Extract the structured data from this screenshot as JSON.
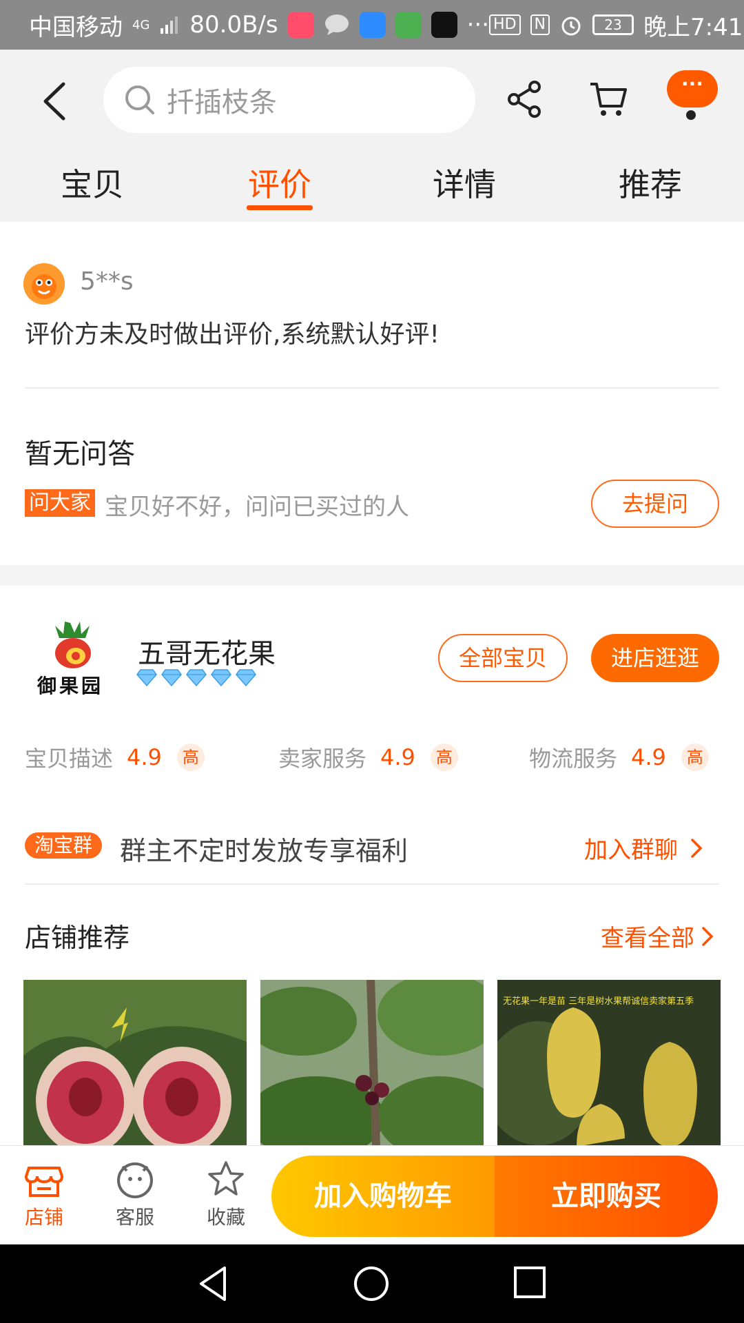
{
  "status_bar": {
    "carrier": "中国移动",
    "network": "4G",
    "speed": "80.0B/s",
    "more": "···",
    "hd": "HD",
    "nfc": "N",
    "battery": "23",
    "time": "晚上7:41"
  },
  "header": {
    "search_placeholder": "扦插枝条",
    "more_label": "···",
    "tabs": [
      {
        "label": "宝贝"
      },
      {
        "label": "评价"
      },
      {
        "label": "详情"
      },
      {
        "label": "推荐"
      }
    ],
    "active_tab": "评价"
  },
  "review": {
    "username": "5**s",
    "text": "评价方未及时做出评价,系统默认好评!"
  },
  "qa": {
    "title": "暂无问答",
    "badge": "问大家",
    "hint": "宝贝好不好，问问已买过的人",
    "ask_button": "去提问"
  },
  "shop": {
    "logo_text": "御果园",
    "name": "五哥无花果",
    "diamond_count": 5,
    "all_items_button": "全部宝贝",
    "enter_button": "进店逛逛",
    "ratings": [
      {
        "label": "宝贝描述",
        "value": "4.9",
        "level": "高"
      },
      {
        "label": "卖家服务",
        "value": "4.9",
        "level": "高"
      },
      {
        "label": "物流服务",
        "value": "4.9",
        "level": "高"
      }
    ],
    "group_badge": "淘宝群",
    "group_text": "群主不定时发放专享福利",
    "group_join": "加入群聊",
    "recommend_title": "店铺推荐",
    "recommend_all": "查看全部",
    "thumb3_caption": "无花果一年是苗 三年是树水果帮诚信卖家第五季"
  },
  "action_bar": {
    "store": "店铺",
    "service": "客服",
    "favorite": "收藏",
    "add_cart": "加入购物车",
    "buy_now": "立即购买"
  },
  "colors": {
    "accent": "#ff5000",
    "cart_gradient": [
      "#ffc800",
      "#ff9a00"
    ],
    "buy_gradient": [
      "#ff7a00",
      "#ff4d00"
    ]
  }
}
